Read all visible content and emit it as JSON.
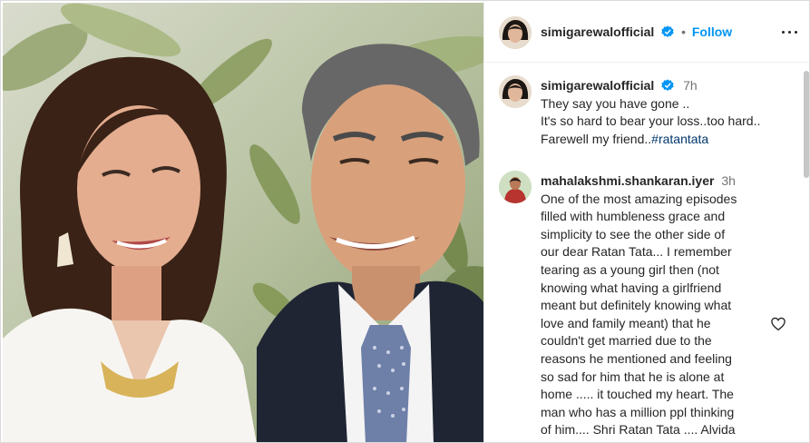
{
  "header": {
    "username": "simigarewalofficial",
    "separator": "•",
    "follow_label": "Follow"
  },
  "caption": {
    "username": "simigarewalofficial",
    "time": "7h",
    "lines": [
      "They say you have gone ..",
      "It's so hard to bear your loss..too hard..",
      "Farewell my friend.."
    ],
    "hashtag": "#ratantata"
  },
  "comment": {
    "username": "mahalakshmi.shankaran.iyer",
    "time": "3h",
    "lines": [
      "One of the most amazing episodes",
      "filled with humbleness grace and",
      "simplicity to see the other side of",
      "our dear Ratan Tata... I remember",
      "tearing as a young girl then (not",
      "knowing what having a girlfriend",
      "meant but definitely knowing what",
      "love and family meant) that he",
      "couldn't get married due to the",
      "reasons he mentioned and feeling",
      "so sad for him that he is alone at",
      "home ..... it touched my heart. The",
      "man who has a million ppl thinking",
      "of him.... Shri Ratan Tata .... Alvida"
    ]
  },
  "icons": {
    "verified": "verified-badge-icon",
    "more": "more-options-icon",
    "like": "heart-icon"
  },
  "colors": {
    "link_blue": "#0095f6",
    "hashtag": "#00376b",
    "secondary_text": "#737373",
    "verified_blue": "#0095f6"
  }
}
